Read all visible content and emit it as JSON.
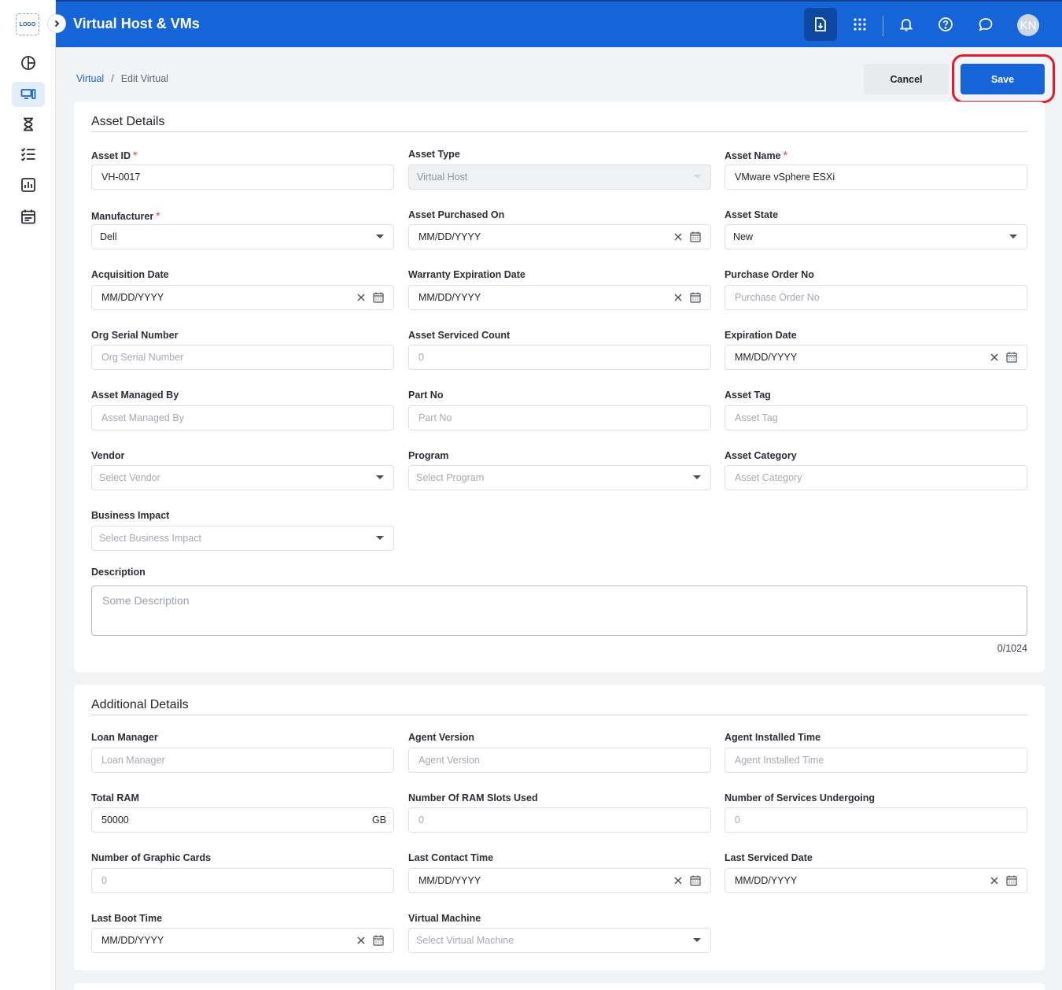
{
  "sidebar": {
    "logo_text": "LOGO",
    "items": [
      {
        "icon": "dashboard-icon"
      },
      {
        "icon": "assets-icon",
        "active": true
      },
      {
        "icon": "hourglass-icon"
      },
      {
        "icon": "checklist-icon"
      },
      {
        "icon": "report-icon"
      },
      {
        "icon": "calendar-icon"
      }
    ]
  },
  "header": {
    "title": "Virtual Host & VMs",
    "avatar_initials": "KN",
    "brand_color": "#1565d8"
  },
  "breadcrumb": {
    "root": "Virtual",
    "separator": "/",
    "current": "Edit Virtual"
  },
  "actions": {
    "cancel_label": "Cancel",
    "save_label": "Save",
    "highlight_color": "#e11d2a"
  },
  "asset_details": {
    "title": "Asset Details",
    "fields": {
      "asset_id": {
        "label": "Asset ID",
        "required": "*",
        "value": "VH-0017"
      },
      "asset_type": {
        "label": "Asset Type",
        "value": "Virtual Host"
      },
      "asset_name": {
        "label": "Asset Name",
        "required": "*",
        "value": "VMware vSphere ESXi"
      },
      "manufacturer": {
        "label": "Manufacturer",
        "required": "*",
        "value": "Dell"
      },
      "asset_purchased_on": {
        "label": "Asset Purchased On",
        "value": "MM/DD/YYYY"
      },
      "asset_state": {
        "label": "Asset State",
        "value": "New"
      },
      "acquisition_date": {
        "label": "Acquisition Date",
        "value": "MM/DD/YYYY"
      },
      "warranty_expiration_date": {
        "label": "Warranty Expiration Date",
        "value": "MM/DD/YYYY"
      },
      "purchase_order_no": {
        "label": "Purchase Order No",
        "placeholder": "Purchase Order No"
      },
      "org_serial_number": {
        "label": "Org Serial Number",
        "placeholder": "Org Serial Number"
      },
      "asset_serviced_count": {
        "label": "Asset Serviced Count",
        "placeholder": "0"
      },
      "expiration_date": {
        "label": "Expiration Date",
        "value": "MM/DD/YYYY"
      },
      "asset_managed_by": {
        "label": "Asset Managed By",
        "placeholder": "Asset Managed By"
      },
      "part_no": {
        "label": "Part No",
        "placeholder": "Part No"
      },
      "asset_tag": {
        "label": "Asset Tag",
        "placeholder": "Asset Tag"
      },
      "vendor": {
        "label": "Vendor",
        "placeholder": "Select Vendor"
      },
      "program": {
        "label": "Program",
        "placeholder": "Select Program"
      },
      "asset_category": {
        "label": "Asset Category",
        "placeholder": "Asset Category"
      },
      "business_impact": {
        "label": "Business Impact",
        "placeholder": "Select Business Impact"
      },
      "description": {
        "label": "Description",
        "placeholder": "Some Description",
        "counter": "0/1024"
      }
    }
  },
  "additional_details": {
    "title": "Additional Details",
    "fields": {
      "loan_manager": {
        "label": "Loan Manager",
        "placeholder": "Loan Manager"
      },
      "agent_version": {
        "label": "Agent Version",
        "placeholder": "Agent Version"
      },
      "agent_installed_time": {
        "label": "Agent Installed Time",
        "placeholder": "Agent Installed Time"
      },
      "total_ram": {
        "label": "Total RAM",
        "value": "50000",
        "unit": "GB"
      },
      "ram_slots_used": {
        "label": "Number Of RAM Slots Used",
        "placeholder": "0"
      },
      "services_undergoing": {
        "label": "Number of Services Undergoing",
        "placeholder": "0"
      },
      "graphic_cards": {
        "label": "Number of Graphic Cards",
        "placeholder": "0"
      },
      "last_contact_time": {
        "label": "Last Contact Time",
        "value": "MM/DD/YYYY"
      },
      "last_serviced_date": {
        "label": "Last Serviced Date",
        "value": "MM/DD/YYYY"
      },
      "last_boot_time": {
        "label": "Last Boot Time",
        "value": "MM/DD/YYYY"
      },
      "virtual_machine": {
        "label": "Virtual Machine",
        "placeholder": "Select Virtual Machine"
      }
    }
  }
}
